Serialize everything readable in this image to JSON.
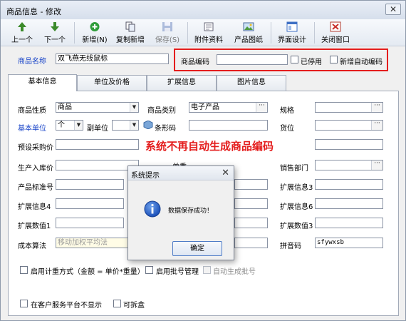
{
  "window": {
    "title": "商品信息 - 修改",
    "close_glyph": "✕"
  },
  "toolbar": {
    "buttons": [
      {
        "label": "上一个",
        "icon": "arrow-up-icon"
      },
      {
        "label": "下一个",
        "icon": "arrow-down-icon"
      },
      {
        "label": "新增(N)",
        "icon": "plus-circle-icon"
      },
      {
        "label": "复制新增",
        "icon": "copy-icon"
      },
      {
        "label": "保存(S)",
        "icon": "floppy-disk-icon",
        "disabled": true
      },
      {
        "label": "附件资料",
        "icon": "attachment-icon"
      },
      {
        "label": "产品图纸",
        "icon": "image-icon"
      },
      {
        "label": "界面设计",
        "icon": "layout-icon"
      },
      {
        "label": "关闭窗口",
        "icon": "close-window-icon"
      }
    ]
  },
  "header": {
    "name_label": "商品名称",
    "name_value": "双飞燕无线鼠标",
    "code_label": "商品编码",
    "code_value": "",
    "disabled_label": "已停用",
    "auto_code_label": "新增自动编码"
  },
  "tabs": [
    "基本信息",
    "单位及价格",
    "扩展信息",
    "图片信息"
  ],
  "form": {
    "nature_label": "商品性质",
    "nature_value": "商品",
    "category_label": "商品类别",
    "category_value": "电子产品",
    "spec_label": "规格",
    "base_unit_label": "基本单位",
    "base_unit_value": "个",
    "sub_unit_label": "副单位",
    "sub_unit_value": "",
    "barcode_label": "条形码",
    "location_label": "货位",
    "purchase_price_label": "预设采购价",
    "inbound_price_label": "生产入库价",
    "weight_label": "单重",
    "sales_dept_label": "销售部门",
    "standard_no_label": "产品标准号",
    "ext3_label": "扩展信息3",
    "ext4_label": "扩展信息4",
    "ext6_label": "扩展信息6",
    "num1_label": "扩展数值1",
    "numx_label": "扩展数值1",
    "num3_label": "扩展数值3",
    "cost_method_label": "成本算法",
    "cost_method_value": "移动加权平均法",
    "pinyin_label": "拼音码",
    "pinyin_value": "sfywxsb",
    "weigh_label": "启用计重方式（金额 = 单价*重量）",
    "batch_label": "启用批号管理",
    "auto_batch_label": "自动生成批号",
    "hide_portal_label": "在客户服务平台不显示",
    "split_label": "可拆盒"
  },
  "annotation": {
    "text": "系统不再自动生成商品编码",
    "color": "#e41d1d"
  },
  "dialog": {
    "title": "系统提示",
    "close_glyph": "✕",
    "message": "数据保存成功！",
    "ok_label": "确定",
    "icon": "info-icon"
  },
  "colors": {
    "accent_red": "#e41d1d",
    "label_blue": "#1743c8",
    "info_blue": "#1a4fb8"
  }
}
